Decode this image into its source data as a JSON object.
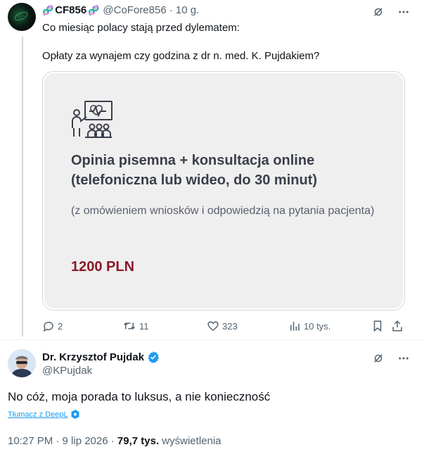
{
  "tweet1": {
    "display_name": "CF856",
    "name_emoji": "🧬",
    "handle": "@CoFore856",
    "time": "· 10 g.",
    "text_line1": "Co miesiąc polacy stają przed dylematem:",
    "text_line2": "Opłaty za wynajem czy godzina z dr n. med. K. Pujdakiem?",
    "card": {
      "title": "Opinia pisemna + konsultacja online (telefoniczna lub wideo, do 30 minut)",
      "subtitle": "(z omówieniem wniosków i odpowiedzią na pytania pacjenta)",
      "price": "1200 PLN"
    },
    "actions": {
      "replies": "2",
      "retweets": "11",
      "likes": "323",
      "views": "10 tys."
    }
  },
  "tweet2": {
    "display_name": "Dr. Krzysztof Pujdak",
    "handle": "@KPujdak",
    "text": "No cóż, moja porada to luksus, a nie konieczność",
    "translate_label": "Tłumacz z DeepL",
    "time": "10:27 PM · 9 lip 2026 · ",
    "views_count": "79,7 tys.",
    "views_label": " wyświetlenia"
  },
  "colors": {
    "text_primary": "#0f1419",
    "text_secondary": "#536471",
    "accent_blue": "#1d9bf0",
    "price_red": "#8b1a28",
    "card_bg": "#efefef"
  },
  "icons": [
    "grok-icon",
    "more-icon",
    "reply-icon",
    "retweet-icon",
    "like-icon",
    "views-icon",
    "bookmark-icon",
    "share-icon",
    "verified-badge-icon",
    "deepl-icon",
    "consultation-icon"
  ]
}
